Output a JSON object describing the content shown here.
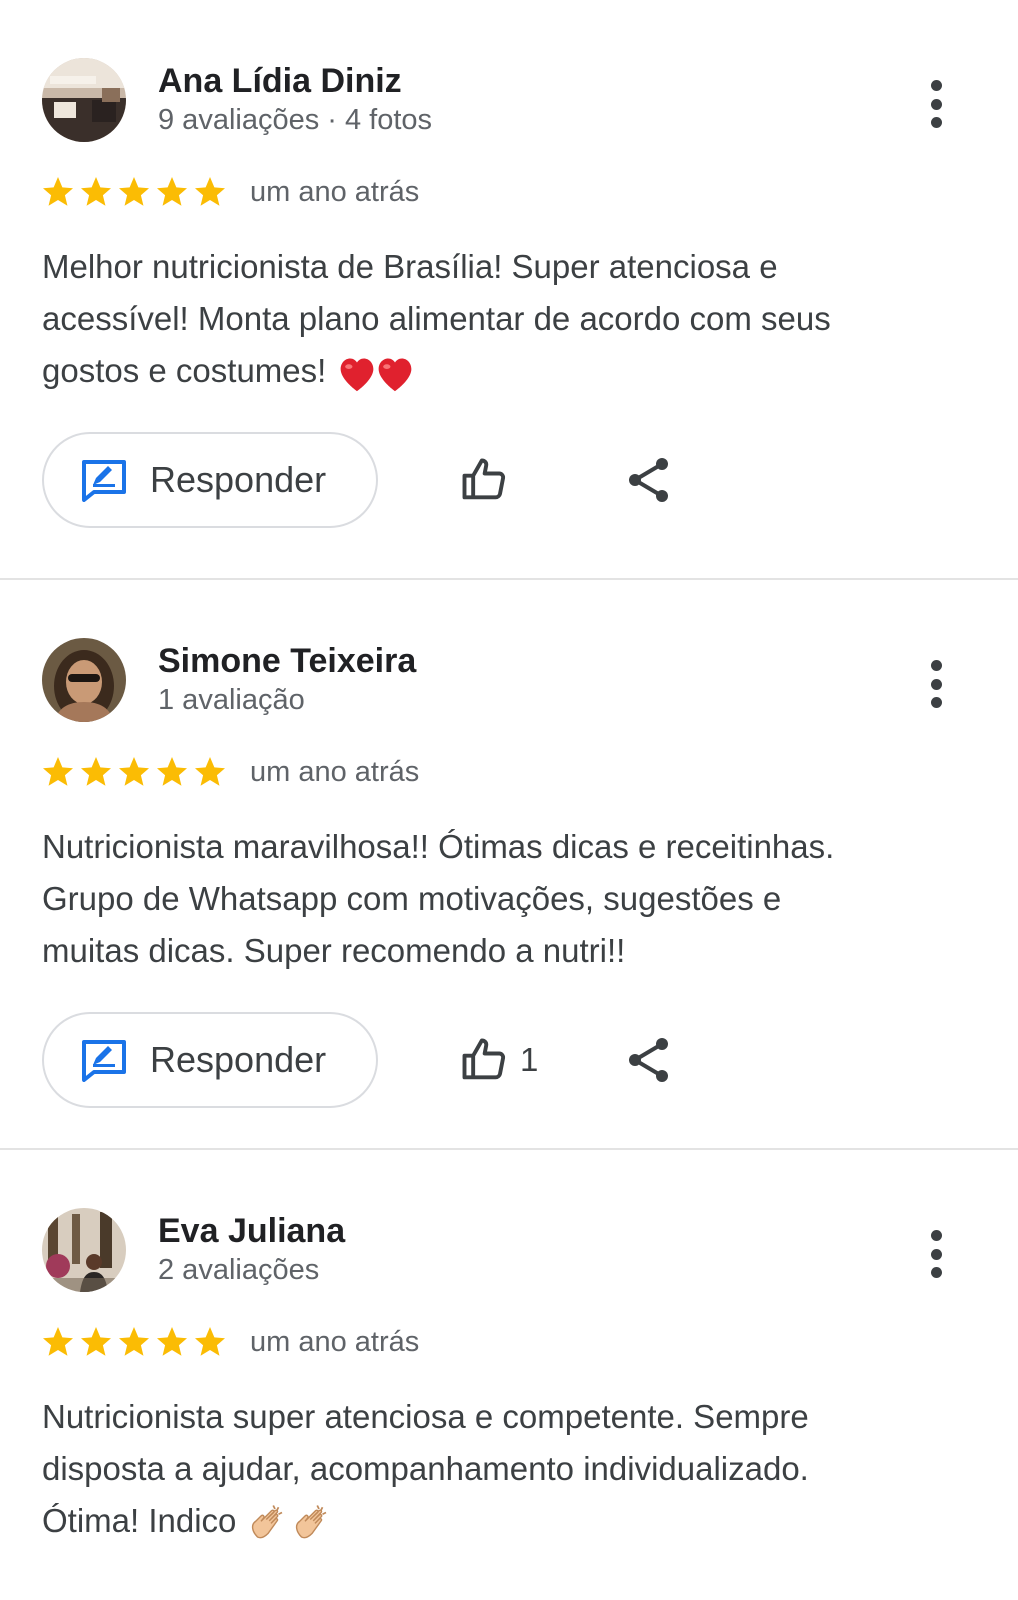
{
  "reviews": [
    {
      "name": "Ana Lídia Diniz",
      "meta": "9 avaliações · 4 fotos",
      "rating": 5,
      "when": "um ano atrás",
      "text_lines": [
        "Melhor nutricionista de Brasília! Super atenciosa e",
        "acessível! Monta plano alimentar de acordo com seus",
        "gostos e costumes!"
      ],
      "emoji": "red-heart-icon x2",
      "reply_label": "Responder",
      "like_count": ""
    },
    {
      "name": "Simone Teixeira",
      "meta": "1 avaliação",
      "rating": 5,
      "when": "um ano atrás",
      "text_lines": [
        "Nutricionista maravilhosa!! Ótimas dicas e receitinhas.",
        "Grupo de Whatsapp com motivações, sugestões e",
        "muitas dicas. Super recomendo a nutri!!"
      ],
      "reply_label": "Responder",
      "like_count": "1"
    },
    {
      "name": "Eva Juliana",
      "meta": "2 avaliações",
      "rating": 5,
      "when": "um ano atrás",
      "text_lines": [
        "Nutricionista super atenciosa e competente. Sempre",
        "disposta a ajudar, acompanhamento individualizado.",
        "Ótima! Indico"
      ],
      "emoji": "clapping-hands-icon x2"
    }
  ],
  "colors": {
    "star": "#fbbc04",
    "reply_icon": "#1a73e8",
    "text": "#3c4043",
    "secondary": "#5f6368",
    "divider": "#e3e3e3"
  }
}
